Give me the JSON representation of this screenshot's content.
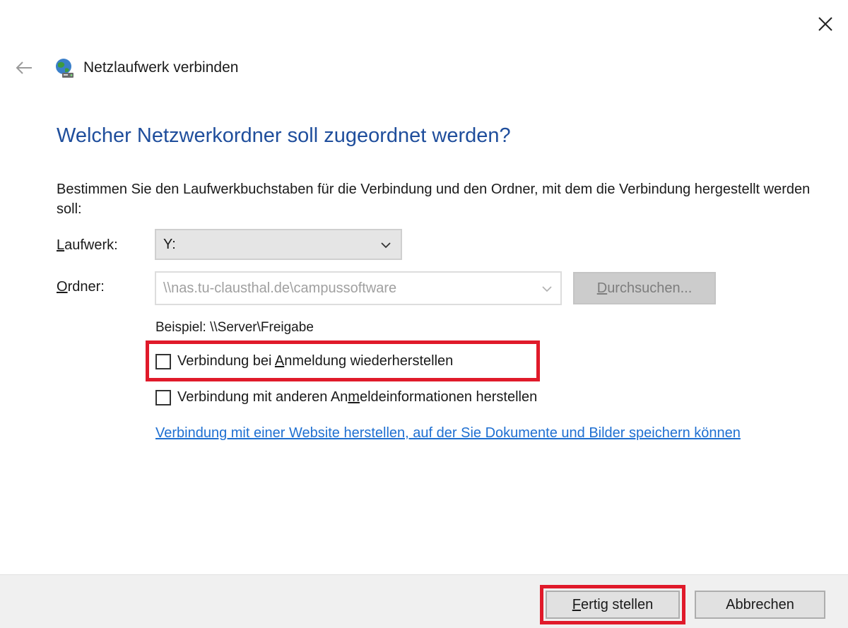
{
  "window": {
    "title": "Netzlaufwerk verbinden",
    "icons": {
      "close": "close-icon",
      "back": "back-arrow-icon",
      "title": "network-drive-icon"
    }
  },
  "main": {
    "heading": "Welcher Netzwerkordner soll zugeordnet werden?",
    "instructions": "Bestimmen Sie den Laufwerkbuchstaben für die Verbindung und den Ordner, mit dem die Verbindung hergestellt werden soll:",
    "drive": {
      "label_mnemonic": "L",
      "label_rest": "aufwerk:",
      "value": "Y:"
    },
    "folder": {
      "label_mnemonic": "O",
      "label_rest": "rdner:",
      "value": "\\\\nas.tu-clausthal.de\\campussoftware"
    },
    "browse": {
      "mnemonic": "D",
      "rest": "urchsuchen..."
    },
    "example": "Beispiel: \\\\Server\\Freigabe",
    "checkbox_reconnect": {
      "pre": "Verbindung bei ",
      "mnemonic": "A",
      "post": "nmeldung wiederherstellen",
      "checked": false
    },
    "checkbox_alt_credentials": {
      "pre": "Verbindung mit anderen An",
      "mnemonic": "m",
      "post": "eldeinformationen herstellen",
      "checked": false
    },
    "website_link": "Verbindung mit einer Website herstellen, auf der Sie Dokumente und Bilder speichern können"
  },
  "footer": {
    "finish": {
      "mnemonic": "F",
      "rest": "ertig stellen"
    },
    "cancel": "Abbrechen"
  },
  "colors": {
    "heading": "#1f4e9c",
    "link": "#1e6fd1",
    "highlight": "#e01a2a",
    "footer_bg": "#f0f0f0"
  }
}
